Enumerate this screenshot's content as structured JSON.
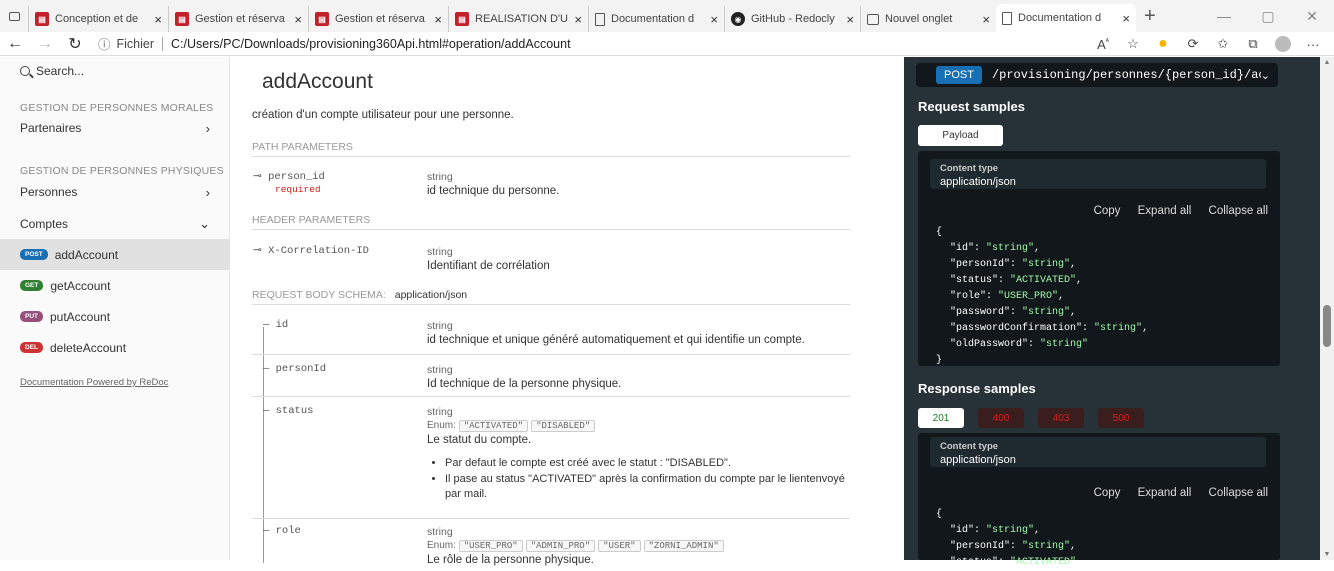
{
  "browser": {
    "tabs": [
      {
        "icon": "pdf",
        "label": "Conception et de"
      },
      {
        "icon": "pdf",
        "label": "Gestion et réserva"
      },
      {
        "icon": "pdf",
        "label": "Gestion et réserva"
      },
      {
        "icon": "pdf",
        "label": "REALISATION D'U"
      },
      {
        "icon": "doc",
        "label": "Documentation d"
      },
      {
        "icon": "github",
        "label": "GitHub - Redocly"
      },
      {
        "icon": "newtab",
        "label": "Nouvel onglet"
      },
      {
        "icon": "doc",
        "label": "Documentation d",
        "active": true
      }
    ],
    "url_scheme": "Fichier",
    "url": "C:/Users/PC/Downloads/provisioning360Api.html#operation/addAccount"
  },
  "menu": {
    "search_placeholder": "Search...",
    "section1": "GESTION DE PERSONNES MORALES",
    "partenaires": "Partenaires",
    "section2": "GESTION DE PERSONNES PHYSIQUES",
    "personnes": "Personnes",
    "comptes": "Comptes",
    "operations": [
      {
        "method": "post",
        "color": "#186fb4",
        "label": "addAccount",
        "active": true
      },
      {
        "method": "get",
        "color": "#2f8132",
        "label": "getAccount"
      },
      {
        "method": "put",
        "color": "#95507c",
        "label": "putAccount"
      },
      {
        "method": "del",
        "color": "#cc3333",
        "label": "deleteAccount"
      }
    ],
    "powered": "Documentation Powered by ReDoc"
  },
  "operation": {
    "title": "addAccount",
    "description": "création d'un compte utilisateur pour une personne.",
    "path_params_header": "PATH PARAMETERS",
    "path_param_name": "person_id",
    "path_param_required": "required",
    "path_param_type": "string",
    "path_param_desc": "id technique du personne.",
    "header_params_header": "HEADER PARAMETERS",
    "header_param_name": "X-Correlation-ID",
    "header_param_type": "string",
    "header_param_desc": "Identifiant de corrélation",
    "body_schema_header": "REQUEST BODY SCHEMA:",
    "body_content_type": "application/json",
    "fields": {
      "id": {
        "name": "id",
        "type": "string",
        "desc": "id technique et unique généré automatiquement et qui identifie un compte."
      },
      "personId": {
        "name": "personId",
        "type": "string",
        "desc": "Id technique de la personne physique."
      },
      "status": {
        "name": "status",
        "type": "string",
        "enum_label": "Enum:",
        "enum": [
          "\"ACTIVATED\"",
          "\"DISABLED\""
        ],
        "desc": "Le statut du compte.",
        "bullets": [
          "Par defaut le compte est créé avec le statut : \"DISABLED\".",
          "Il pase au status \"ACTIVATED\" après la confirmation du compte par le lientenvoyé par mail."
        ]
      },
      "role": {
        "name": "role",
        "type": "string",
        "enum_label": "Enum:",
        "enum": [
          "\"USER_PRO\"",
          "\"ADMIN_PRO\"",
          "\"USER\"",
          "\"ZORNI_ADMIN\""
        ],
        "desc": "Le rôle de la personne physique."
      }
    }
  },
  "samples": {
    "method": "POST",
    "path": "/provisioning/personnes/{person_id}/ac...",
    "request_title": "Request samples",
    "payload_tab": "Payload",
    "content_type_label": "Content type",
    "content_type_value": "application/json",
    "copy": "Copy",
    "expand_all": "Expand all",
    "collapse_all": "Collapse all",
    "request_json": [
      {
        "k": "\"id\"",
        "v": "\"string\""
      },
      {
        "k": "\"personId\"",
        "v": "\"string\""
      },
      {
        "k": "\"status\"",
        "v": "\"ACTIVATED\""
      },
      {
        "k": "\"role\"",
        "v": "\"USER_PRO\""
      },
      {
        "k": "\"password\"",
        "v": "\"string\""
      },
      {
        "k": "\"passwordConfirmation\"",
        "v": "\"string\""
      },
      {
        "k": "\"oldPassword\"",
        "v": "\"string\""
      }
    ],
    "response_title": "Response samples",
    "response_tabs": [
      "201",
      "400",
      "403",
      "500"
    ],
    "response_json": [
      {
        "k": "\"id\"",
        "v": "\"string\""
      },
      {
        "k": "\"personId\"",
        "v": "\"string\""
      },
      {
        "k": "\"status\"",
        "v": "\"ACTIVATED\""
      }
    ]
  }
}
